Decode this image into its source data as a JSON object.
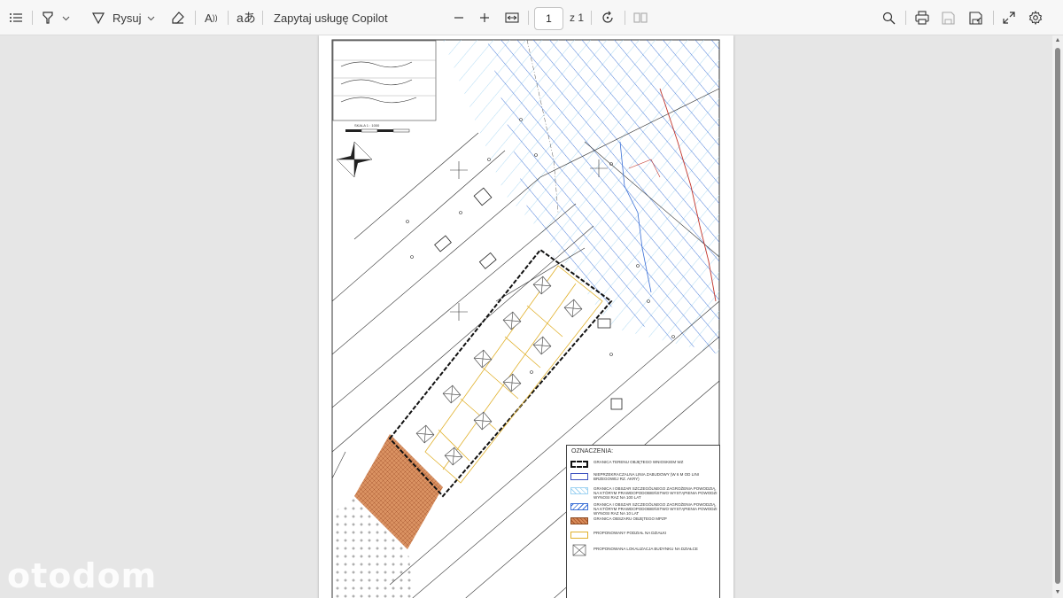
{
  "toolbar": {
    "draw_label": "Rysuj",
    "copilot_label": "Zapytaj usługę Copilot",
    "page_current": "1",
    "page_total": "z 1"
  },
  "document": {
    "legend_title": "OZNACZENIA:",
    "legend_items": [
      "GRANICA TERENU OBJĘTEGO WNIOSKIEM WZ",
      "NIEPRZEKRACZALNA LINIA ZABUDOWY (W 6 M OD LINI BRZEGOWEJ RZ. AKRY)",
      "GRANICA I OBSZAR SZCZEGÓLNEGO ZAGROŻENIA POWODZIĄ, NA KTÓRYM PRAWDOPODOBIEŃSTWO WYSTĄPIENIA POWODZI WYNOSI RAZ NA 100 LAT",
      "GRANICA I OBSZAR SZCZEGÓLNEGO ZAGROŻENIA POWODZIĄ, NA KTÓRYM PRAWDOPODOBIEŃSTWO WYSTĄPIENIA POWODZI WYNOSI RAZ NA 10 LAT",
      "GRANICA OBSZARU OBJĘTEGO MPZP",
      "PROPONOWANY PODZIAŁ NA DZIAŁKI",
      "PROPONOWANA LOKALIZACJA BUDYNKU NA DZIAŁCE"
    ],
    "scale_label": "SKALA 1 : 1000"
  },
  "watermark": "otodom",
  "colors": {
    "hatch_blue": "#3a6fd6",
    "hatch_light": "#9fd3f2",
    "mpzp_area": "#c9733d",
    "parcel_lines": "#e1b12c",
    "boundary_red": "#c2342a"
  }
}
